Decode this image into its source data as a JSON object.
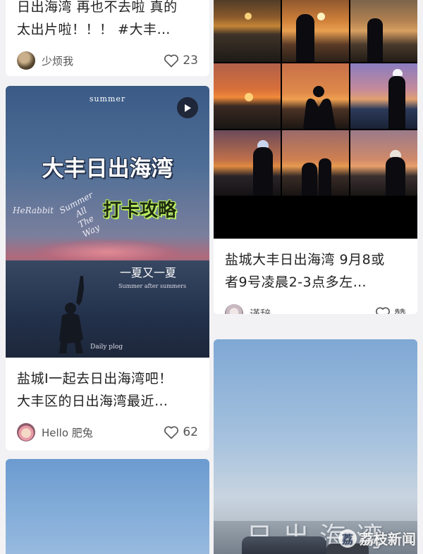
{
  "posts": [
    {
      "title": "日出海湾 再也不去啦 真的太出片啦！！！ #大丰…",
      "title_line1": "日出海湾 再也不去啦 真的",
      "title_line2": "太出片啦！！！ #大丰…",
      "author": "少烦我",
      "likes": "23",
      "like_icon": "heart-outline-icon"
    },
    {
      "cover_texts": {
        "season": "summer",
        "title_main": "大丰日出海湾",
        "subtitle": "打卡攻略",
        "script_brand": "HeRabbit",
        "script_phrase": "Summer All The Way",
        "script_line1": "Summer",
        "script_line2": "All",
        "script_line3": "The",
        "script_line4": "Way",
        "cn_phrase": "一夏又一夏",
        "en_phrase": "Summer after summers",
        "footer": "Daily plog"
      },
      "has_video": true,
      "title_line1": "盐城I一起去日出海湾吧！",
      "title_line2": "大丰区的日出海湾最近…",
      "author": "Hello 肥兔",
      "likes": "62",
      "like_icon": "heart-outline-icon"
    },
    {
      "title_line1": "盐城大丰日出海湾 9月8或",
      "title_line2": "者9号凌晨2-3点多左…",
      "author": "谨辞",
      "likes": "赞",
      "like_icon": "heart-outline-icon"
    },
    {
      "sign_text": "日出海湾"
    }
  ],
  "watermark": {
    "logo_char": "荔",
    "text": "荔枝新闻"
  },
  "colors": {
    "background": "#f2f2f4",
    "card": "#ffffff",
    "title_text": "#222222",
    "meta_text": "#555555"
  }
}
